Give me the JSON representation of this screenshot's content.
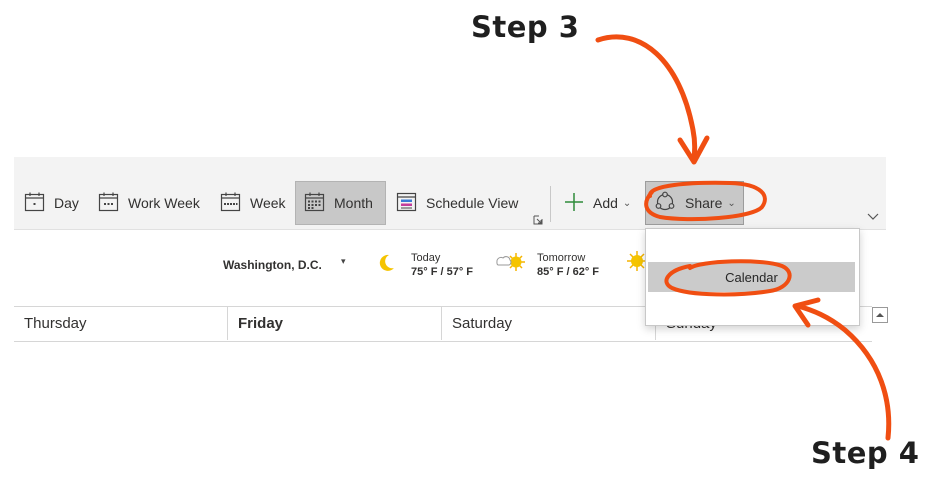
{
  "annotations": {
    "step3": "Step 3",
    "step4": "Step 4",
    "accent": "#f04e12"
  },
  "ribbon": {
    "day_label": "Day",
    "work_week_label": "Work Week",
    "week_label": "Week",
    "month_label": "Month",
    "schedule_view_label": "Schedule View",
    "add_label": "Add",
    "share_label": "Share",
    "icons": [
      "calendar-day-icon",
      "calendar-workweek-icon",
      "calendar-week-icon",
      "calendar-month-icon",
      "schedule-view-icon",
      "dialog-launcher-icon",
      "plus-icon",
      "chevron-down-icon",
      "share-icon",
      "collapse-ribbon-icon"
    ]
  },
  "weather": {
    "location": "Washington, D.C.",
    "today": {
      "label": "Today",
      "temps": "75° F / 57° F",
      "icon": "moon-icon"
    },
    "tomorrow": {
      "label": "Tomorrow",
      "temps": "85° F / 62° F",
      "icon": "partly-sunny-icon"
    },
    "third_icon": "sun-icon"
  },
  "calendar": {
    "day_headers": [
      "Thursday",
      "Friday",
      "Saturday",
      "Sunday"
    ]
  },
  "share_menu": {
    "items": [
      "Calendar"
    ]
  }
}
